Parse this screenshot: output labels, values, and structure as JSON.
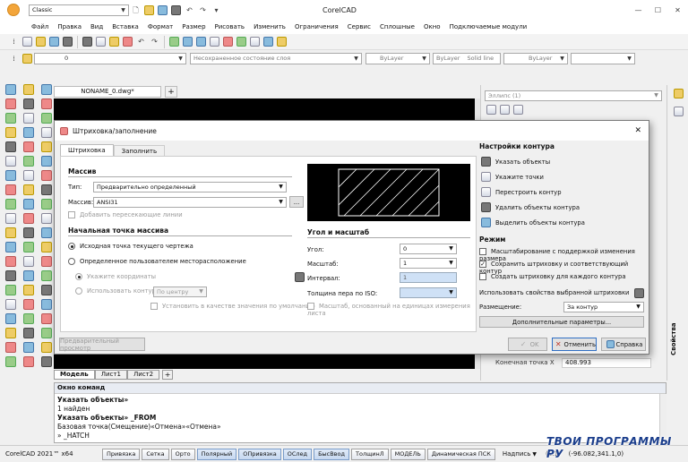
{
  "app": {
    "title": "CorelCAD",
    "workspace": "Classic"
  },
  "menu": [
    "Файл",
    "Правка",
    "Вид",
    "Вставка",
    "Формат",
    "Размер",
    "Рисовать",
    "Изменить",
    "Ограничения",
    "Сервис",
    "Сплошные",
    "Окно",
    "Подключаемые модули"
  ],
  "layer_toolbar": {
    "layer_value": "0",
    "layer_state": "Несохраненное состояние слоя",
    "color": "ByLayer",
    "linetype": "ByLayer",
    "linetype_name": "Solid line",
    "lineweight": "ByLayer"
  },
  "tabs": {
    "document": "NONAME_0.dwg*",
    "add": "+"
  },
  "layout_tabs": [
    "Модель",
    "Лист1",
    "Лист2"
  ],
  "layout_add": "+",
  "properties": {
    "title": "Эллипс (1)",
    "row_label": "Конечная точка X",
    "row_value": "408.993",
    "side_tab": "Свойства"
  },
  "dialog": {
    "title": "Штриховка/заполнение",
    "close": "✕",
    "tabs": [
      "Штриховка",
      "Заполнить"
    ],
    "pattern": {
      "heading": "Массив",
      "type_label": "Тип:",
      "type_value": "Предварительно определенный",
      "pattern_label": "Массив:",
      "pattern_value": "ANSI31",
      "browse": "...",
      "add_crossing": "Добавить пересекающие линии"
    },
    "origin": {
      "heading": "Начальная точка массива",
      "current": "Исходная точка текущего чертежа",
      "user": "Определенное пользователем месторасположение",
      "specify": "Укажите координаты",
      "use_boundary": "Использовать контур:",
      "boundary_value": "По центру",
      "store_default": "Установить в качестве значения по умолчанию"
    },
    "angle": {
      "heading": "Угол и масштаб",
      "angle_label": "Угол:",
      "angle_value": "0",
      "scale_label": "Масштаб:",
      "scale_value": "1",
      "interval_label": "Интервал:",
      "interval_value": "1",
      "iso_label": "Толщина пера по ISO:",
      "paper_scale": "Масштаб, основанный на единицах измерения листа"
    },
    "boundary": {
      "heading": "Настройки контура",
      "items": [
        "Указать объекты",
        "Укажите точки",
        "Перестроить контур",
        "Удалить объекты контура",
        "Выделить объекты контура"
      ]
    },
    "mode": {
      "heading": "Режим",
      "annotative": "Масштабирование с поддержкой изменения размера",
      "associative": "Сохранить штриховку и соответствующий контур",
      "separate": "Создать штриховку для каждого контура",
      "inherit": "Использовать свойства выбранной штриховки",
      "placement_label": "Размещение:",
      "placement_value": "За контур",
      "more": "Дополнительные параметры..."
    },
    "buttons": {
      "preview": "Предварительный просмотр",
      "ok": "OK",
      "cancel": "Отменить",
      "help": "Справка"
    }
  },
  "command": {
    "title": "Окно команд",
    "lines": [
      "Указать объекты»",
      "1 найден",
      "Указать объекты» _FROM",
      "Базовая точка(Смещение)«Отмена»«Отмена»",
      "» _HATCH"
    ],
    "bold": [
      true,
      false,
      true,
      false,
      false
    ]
  },
  "status": {
    "version": "CorelCAD 2021™ x64",
    "toggles": [
      "Привязка",
      "Сетка",
      "Орто",
      "Полярный",
      "ОПривязка",
      "ОСлед",
      "БысВвод",
      "ТолщинЛ",
      "МОДЕЛЬ",
      "Динамическая ПСК"
    ],
    "active": [
      false,
      false,
      false,
      true,
      true,
      true,
      true,
      false,
      false,
      false
    ],
    "annot": "Надпись",
    "coords": "(1:1)    (-96.082,341.1,0)"
  },
  "watermark": "ТВОИ ПРОГРАММЫ РУ",
  "colors": {
    "accent_blue": "#2f6fc4",
    "canvas_black": "#000000",
    "close_red": "#c0392b"
  }
}
